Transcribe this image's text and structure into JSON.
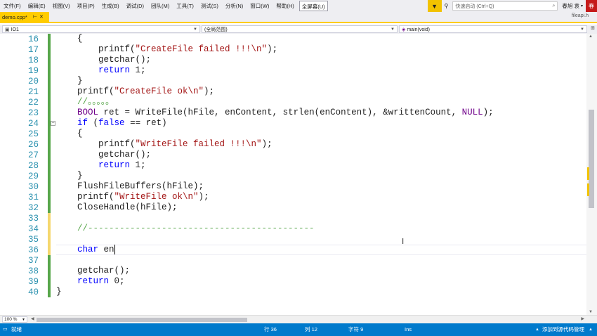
{
  "menubar": {
    "items": [
      "文件(F)",
      "编辑(E)",
      "视图(V)",
      "项目(P)",
      "生成(B)",
      "调试(D)",
      "团队(M)",
      "工具(T)",
      "测试(S)",
      "分析(N)",
      "窗口(W)",
      "帮助(H)"
    ],
    "fullscreen_label": "全屏幕(U)",
    "quick_launch_placeholder": "快速启动 (Ctrl+Q)",
    "user_name": "春旭 袁",
    "user_avatar_letter": "春"
  },
  "tabs": {
    "active_tab": "demo.cpp*",
    "preview_tab": "fileapi.h"
  },
  "navbar": {
    "project": "IO1",
    "scope": "(全局范围)",
    "function": "main(void)"
  },
  "editor": {
    "lines": [
      {
        "num": "16",
        "tokens": [
          {
            "t": "plain",
            "s": "    {"
          }
        ]
      },
      {
        "num": "17",
        "tokens": [
          {
            "t": "plain",
            "s": "        printf("
          },
          {
            "t": "str",
            "s": "\"CreateFile failed !!!\\n\""
          },
          {
            "t": "plain",
            "s": ");"
          }
        ]
      },
      {
        "num": "18",
        "tokens": [
          {
            "t": "plain",
            "s": "        getchar();"
          }
        ]
      },
      {
        "num": "19",
        "tokens": [
          {
            "t": "plain",
            "s": "        "
          },
          {
            "t": "kw",
            "s": "return"
          },
          {
            "t": "plain",
            "s": " 1;"
          }
        ]
      },
      {
        "num": "20",
        "tokens": [
          {
            "t": "plain",
            "s": "    }"
          }
        ]
      },
      {
        "num": "21",
        "tokens": [
          {
            "t": "plain",
            "s": "    printf("
          },
          {
            "t": "str",
            "s": "\"CreateFile ok\\n\""
          },
          {
            "t": "plain",
            "s": ");"
          }
        ]
      },
      {
        "num": "22",
        "tokens": [
          {
            "t": "cm",
            "s": "    //。。。。。"
          }
        ]
      },
      {
        "num": "23",
        "tokens": [
          {
            "t": "plain",
            "s": "    "
          },
          {
            "t": "macro",
            "s": "BOOL"
          },
          {
            "t": "plain",
            "s": " ret = WriteFile(hFile, enContent, strlen(enContent), &writtenCount, "
          },
          {
            "t": "macro",
            "s": "NULL"
          },
          {
            "t": "plain",
            "s": ");"
          }
        ]
      },
      {
        "num": "24",
        "tokens": [
          {
            "t": "plain",
            "s": "    "
          },
          {
            "t": "kw",
            "s": "if"
          },
          {
            "t": "plain",
            "s": " ("
          },
          {
            "t": "kw",
            "s": "false"
          },
          {
            "t": "plain",
            "s": " == ret)"
          }
        ]
      },
      {
        "num": "25",
        "tokens": [
          {
            "t": "plain",
            "s": "    {"
          }
        ]
      },
      {
        "num": "26",
        "tokens": [
          {
            "t": "plain",
            "s": "        printf("
          },
          {
            "t": "str",
            "s": "\"WriteFile failed !!!\\n\""
          },
          {
            "t": "plain",
            "s": ");"
          }
        ]
      },
      {
        "num": "27",
        "tokens": [
          {
            "t": "plain",
            "s": "        getchar();"
          }
        ]
      },
      {
        "num": "28",
        "tokens": [
          {
            "t": "plain",
            "s": "        "
          },
          {
            "t": "kw",
            "s": "return"
          },
          {
            "t": "plain",
            "s": " 1;"
          }
        ]
      },
      {
        "num": "29",
        "tokens": [
          {
            "t": "plain",
            "s": "    }"
          }
        ]
      },
      {
        "num": "30",
        "tokens": [
          {
            "t": "plain",
            "s": "    FlushFileBuffers(hFile);"
          }
        ]
      },
      {
        "num": "31",
        "tokens": [
          {
            "t": "plain",
            "s": "    printf("
          },
          {
            "t": "str",
            "s": "\"WriteFile ok\\n\""
          },
          {
            "t": "plain",
            "s": ");"
          }
        ]
      },
      {
        "num": "32",
        "tokens": [
          {
            "t": "plain",
            "s": "    CloseHandle(hFile);"
          }
        ]
      },
      {
        "num": "33",
        "tokens": [
          {
            "t": "plain",
            "s": ""
          }
        ]
      },
      {
        "num": "34",
        "tokens": [
          {
            "t": "cm",
            "s": "    //-------------------------------------------"
          }
        ]
      },
      {
        "num": "35",
        "tokens": [
          {
            "t": "plain",
            "s": ""
          }
        ]
      },
      {
        "num": "36",
        "tokens": [
          {
            "t": "plain",
            "s": "    "
          },
          {
            "t": "kw",
            "s": "char"
          },
          {
            "t": "plain",
            "s": " en"
          }
        ]
      },
      {
        "num": "37",
        "tokens": [
          {
            "t": "plain",
            "s": ""
          }
        ]
      },
      {
        "num": "38",
        "tokens": [
          {
            "t": "plain",
            "s": "    getchar();"
          }
        ]
      },
      {
        "num": "39",
        "tokens": [
          {
            "t": "plain",
            "s": "    "
          },
          {
            "t": "kw",
            "s": "return"
          },
          {
            "t": "plain",
            "s": " 0;"
          }
        ]
      },
      {
        "num": "40",
        "tokens": [
          {
            "t": "plain",
            "s": "}"
          }
        ]
      }
    ]
  },
  "zoom": "100 %",
  "statusbar": {
    "ready": "就绪",
    "line": "行 36",
    "column": "列 12",
    "char": "字符 9",
    "mode": "Ins",
    "source_control": "添加到源代码管理"
  },
  "colors": {
    "accent": "#007acc",
    "tab_active": "#ffcc00",
    "keyword": "#0000ff",
    "string": "#a31515",
    "comment": "#57a64a",
    "macro": "#6f008a",
    "line_number": "#2b91af",
    "change_saved": "#57a64a",
    "change_unsaved": "#f5d76e"
  }
}
